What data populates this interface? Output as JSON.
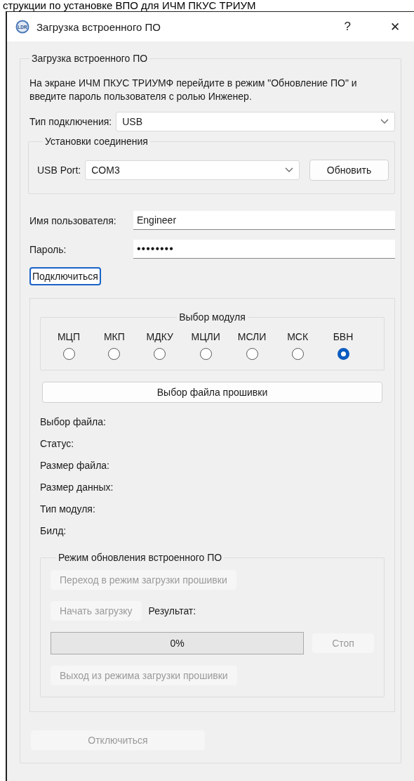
{
  "page_caption": "струкции по установке ВПО для ИЧМ ПКУС ТРИУМ",
  "window": {
    "app_icon_text": "LDR",
    "title": "Загрузка встроенного ПО",
    "help_button": "?",
    "close_button": "✕"
  },
  "main_group": {
    "title": "Загрузка встроенного ПО",
    "instruction": "На экране ИЧМ ПКУС ТРИУМФ перейдите в режим \"Обновление ПО\" и введите пароль пользователя с ролью Инженер.",
    "connection_type": {
      "label": "Тип подключения:",
      "value": "USB"
    },
    "connection_settings": {
      "title": "Установки соединения",
      "port_label": "USB Port:",
      "port_value": "COM3",
      "refresh_button": "Обновить"
    },
    "username": {
      "label": "Имя пользователя:",
      "value": "Engineer"
    },
    "password": {
      "label": "Пароль:",
      "value": "••••••••"
    },
    "connect_button": {
      "label": "Подключиться",
      "focused": true
    },
    "firmware_panel": {
      "module_group": {
        "title": "Выбор модуля",
        "modules": [
          {
            "label": "МЦП",
            "selected": false
          },
          {
            "label": "МКП",
            "selected": false
          },
          {
            "label": "МДКУ",
            "selected": false
          },
          {
            "label": "МЦЛИ",
            "selected": false
          },
          {
            "label": "МСЛИ",
            "selected": false
          },
          {
            "label": "МСК",
            "selected": false
          },
          {
            "label": "БВН",
            "selected": true
          }
        ]
      },
      "select_file_button": "Выбор файла прошивки",
      "info_labels": [
        "Выбор файла:",
        "Статус:",
        "Размер файла:",
        "Размер данных:",
        "Тип модуля:",
        "Билд:"
      ],
      "update_mode": {
        "title": "Режим обновления встроенного ПО",
        "enter_button": {
          "label": "Переход в режим загрузки прошивки",
          "disabled": true
        },
        "start_button": {
          "label": "Начать загрузку",
          "disabled": true
        },
        "result_label": "Результат:",
        "progress": {
          "level": 0,
          "text": "0%"
        },
        "stop_button": {
          "label": "Стоп",
          "disabled": true
        },
        "exit_button": {
          "label": "Выход из режима загрузки прошивки",
          "disabled": true
        }
      }
    },
    "disconnect_button": {
      "label": "Отключиться",
      "disabled": true
    }
  }
}
